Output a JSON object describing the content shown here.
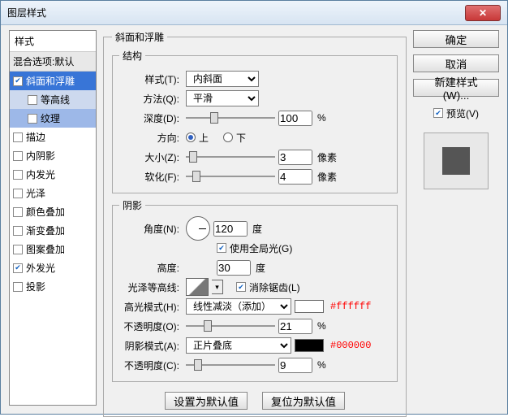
{
  "window": {
    "title": "图层样式"
  },
  "buttons": {
    "ok": "确定",
    "cancel": "取消",
    "new_style": "新建样式(W)...",
    "preview_label": "预览(V)",
    "make_default": "设置为默认值",
    "reset_default": "复位为默认值"
  },
  "styles": {
    "header": "样式",
    "blend": "混合选项:默认",
    "items": [
      {
        "label": "斜面和浮雕",
        "checked": true
      },
      {
        "label": "等高线",
        "checked": false
      },
      {
        "label": "纹理",
        "checked": false
      },
      {
        "label": "描边",
        "checked": false
      },
      {
        "label": "内阴影",
        "checked": false
      },
      {
        "label": "内发光",
        "checked": false
      },
      {
        "label": "光泽",
        "checked": false
      },
      {
        "label": "颜色叠加",
        "checked": false
      },
      {
        "label": "渐变叠加",
        "checked": false
      },
      {
        "label": "图案叠加",
        "checked": false
      },
      {
        "label": "外发光",
        "checked": true
      },
      {
        "label": "投影",
        "checked": false
      }
    ]
  },
  "panel": {
    "title": "斜面和浮雕",
    "structure": {
      "legend": "结构",
      "style_label": "样式(T):",
      "style_value": "内斜面",
      "technique_label": "方法(Q):",
      "technique_value": "平滑",
      "depth_label": "深度(D):",
      "depth_value": "100",
      "depth_unit": "%",
      "direction_label": "方向:",
      "up": "上",
      "down": "下",
      "size_label": "大小(Z):",
      "size_value": "3",
      "size_unit": "像素",
      "soften_label": "软化(F):",
      "soften_value": "4",
      "soften_unit": "像素"
    },
    "shading": {
      "legend": "阴影",
      "angle_label": "角度(N):",
      "angle_value": "120",
      "angle_unit": "度",
      "global_label": "使用全局光(G)",
      "altitude_label": "高度:",
      "altitude_value": "30",
      "altitude_unit": "度",
      "gloss_label": "光泽等高线:",
      "antialias_label": "消除锯齿(L)",
      "highlight_mode_label": "高光模式(H):",
      "highlight_mode_value": "线性减淡（添加）",
      "highlight_color_annot": "#ffffff",
      "highlight_opacity_label": "不透明度(O):",
      "highlight_opacity_value": "21",
      "highlight_opacity_unit": "%",
      "shadow_mode_label": "阴影模式(A):",
      "shadow_mode_value": "正片叠底",
      "shadow_color_annot": "#000000",
      "shadow_opacity_label": "不透明度(C):",
      "shadow_opacity_value": "9",
      "shadow_opacity_unit": "%"
    }
  }
}
